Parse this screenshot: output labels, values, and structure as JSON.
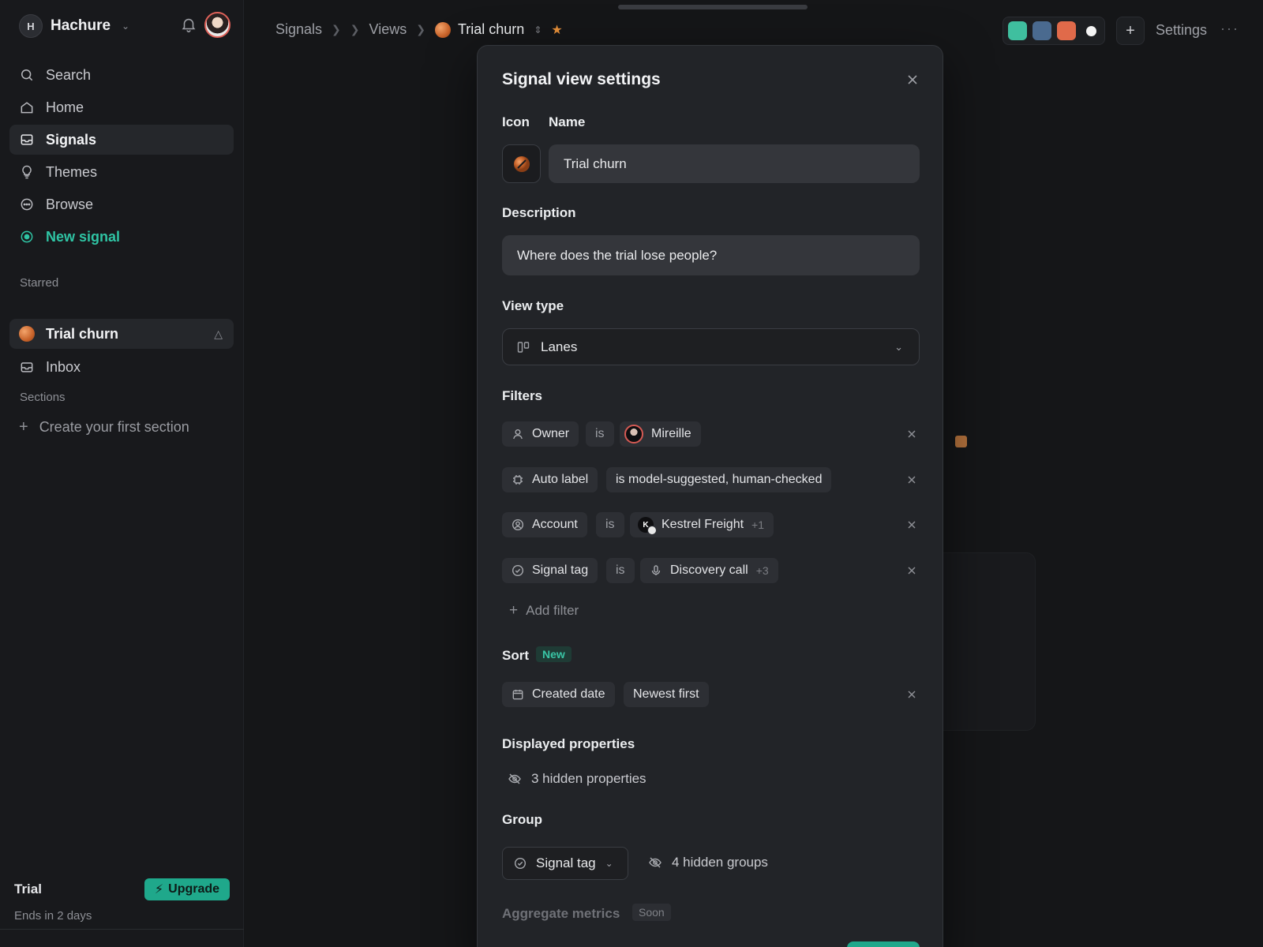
{
  "workspace": {
    "initial": "H",
    "name": "Hachure"
  },
  "sidebar": {
    "nav": [
      {
        "label": "Search",
        "icon": "search-icon"
      },
      {
        "label": "Home",
        "icon": "home-icon"
      },
      {
        "label": "Signals",
        "icon": "inbox-icon",
        "active": true
      },
      {
        "label": "Themes",
        "icon": "lightbulb-icon"
      },
      {
        "label": "Browse",
        "icon": "browse-icon"
      },
      {
        "label": "New signal",
        "icon": "record-icon",
        "accent": "#2fc4a4"
      }
    ],
    "starred_label": "Starred",
    "starred_item": "Trial churn",
    "inbox_label": "Inbox",
    "sections_label": "Sections",
    "create_section": "Create your first section",
    "trial_label": "Trial",
    "trial_ends": "Ends in 2 days",
    "upgrade_label": "Upgrade"
  },
  "header": {
    "breadcrumbs": [
      "Signals",
      "Views",
      "Trial churn"
    ],
    "swatches": [
      "#3fbf9f",
      "#4a6a8f",
      "#e06a4a"
    ],
    "settings_label": "Settings"
  },
  "modal": {
    "title": "Signal view settings",
    "icon_label": "Icon",
    "name_label": "Name",
    "name_value": "Trial churn",
    "description_label": "Description",
    "description_value": "Where does the trial lose people?",
    "view_type_label": "View type",
    "view_type_value": "Lanes",
    "filters_label": "Filters",
    "filters": [
      {
        "field": "Owner",
        "op": "is",
        "value": "Mireille",
        "extra": ""
      },
      {
        "field": "Auto label",
        "op": "",
        "value": "is model-suggested, human-checked",
        "extra": ""
      },
      {
        "field": "Account",
        "op": "is",
        "value": "Kestrel Freight",
        "extra": "+1"
      },
      {
        "field": "Signal tag",
        "op": "is",
        "value": "Discovery call",
        "extra": "+3"
      }
    ],
    "account_initial": "K",
    "add_filter": "Add filter",
    "sort_label": "Sort",
    "sort_badge": "New",
    "sort_field": "Created date",
    "sort_order": "Newest first",
    "displayed_label": "Displayed properties",
    "hidden_properties": "3 hidden properties",
    "group_label": "Group",
    "group_value": "Signal tag",
    "hidden_groups": "4 hidden groups",
    "aggregate_label": "Aggregate metrics",
    "aggregate_badge": "Soon"
  }
}
